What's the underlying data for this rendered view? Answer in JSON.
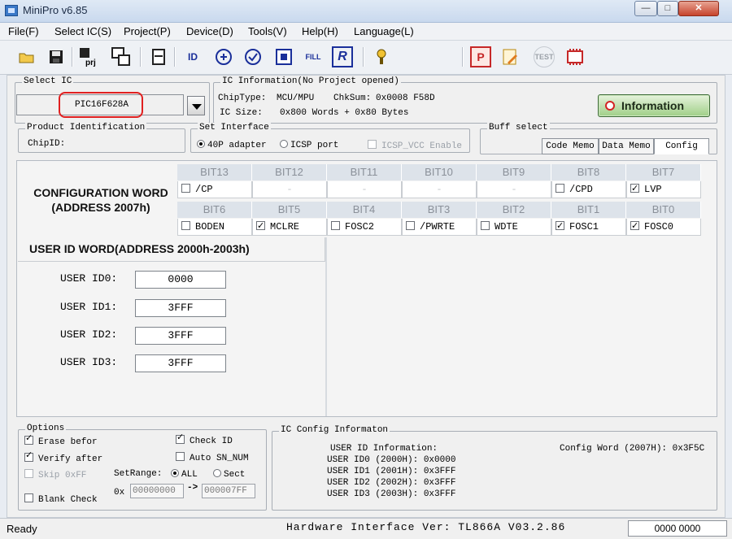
{
  "window": {
    "title": "MiniPro v6.85"
  },
  "menu": [
    "File(F)",
    "Select IC(S)",
    "Project(P)",
    "Device(D)",
    "Tools(V)",
    "Help(H)",
    "Language(L)"
  ],
  "toolbar": {
    "icons": [
      "open-icon",
      "save-icon",
      "save-project-icon",
      "load-project-icon",
      "buffer-icon",
      "read-icon",
      "write-icon",
      "verify-icon",
      "blank-check-icon",
      "fill-icon",
      "read-id-icon",
      "help-icon",
      "program-icon",
      "edit-icon",
      "test-icon",
      "chip-icon"
    ],
    "labels": {
      "read": "ID",
      "fill": "FILL",
      "read_id": "R",
      "program": "P",
      "test": "TEST"
    }
  },
  "select_ic": {
    "legend": "Select IC",
    "value": "PIC16F628A"
  },
  "ic_info": {
    "legend": "IC Information(No Project opened)",
    "chip_type_label": "ChipType:",
    "chip_type": "MCU/MPU",
    "chksum_label": "ChkSum:",
    "chksum": "0x0008 F58D",
    "ic_size_label": "IC Size:",
    "ic_size": "0x800 Words + 0x80 Bytes"
  },
  "info_button": "Information",
  "product_id": {
    "legend": "Product Identification",
    "chip_id_label": "ChipID:"
  },
  "interface": {
    "legend": "Set Interface",
    "adapter": "40P adapter",
    "icsp": "ICSP port",
    "icsp_vcc": "ICSP_VCC Enable"
  },
  "buff": {
    "legend": "Buff select",
    "tabs": [
      "Code Memo",
      "Data Memo",
      "Config"
    ]
  },
  "config": {
    "title_line1": "CONFIGURATION WORD",
    "title_line2": "(ADDRESS 2007h)",
    "row1_heads": [
      "BIT13",
      "BIT12",
      "BIT11",
      "BIT10",
      "BIT9",
      "BIT8",
      "BIT7"
    ],
    "row1_cells": [
      {
        "label": "/CP",
        "checked": false
      },
      {
        "label": "-",
        "dash": true
      },
      {
        "label": "-",
        "dash": true
      },
      {
        "label": "-",
        "dash": true
      },
      {
        "label": "-",
        "dash": true
      },
      {
        "label": "/CPD",
        "checked": false
      },
      {
        "label": "LVP",
        "checked": true
      }
    ],
    "row2_heads": [
      "BIT6",
      "BIT5",
      "BIT4",
      "BIT3",
      "BIT2",
      "BIT1",
      "BIT0"
    ],
    "row2_cells": [
      {
        "label": "BODEN",
        "checked": false
      },
      {
        "label": "MCLRE",
        "checked": true
      },
      {
        "label": "FOSC2",
        "checked": false
      },
      {
        "label": "/PWRTE",
        "checked": false
      },
      {
        "label": "WDTE",
        "checked": false
      },
      {
        "label": "FOSC1",
        "checked": true
      },
      {
        "label": "FOSC0",
        "checked": true
      }
    ]
  },
  "user_id": {
    "title": "USER ID WORD(ADDRESS 2000h-2003h)",
    "rows": [
      {
        "label": "USER ID0:",
        "value": "0000"
      },
      {
        "label": "USER ID1:",
        "value": "3FFF"
      },
      {
        "label": "USER ID2:",
        "value": "3FFF"
      },
      {
        "label": "USER ID3:",
        "value": "3FFF"
      }
    ]
  },
  "options": {
    "legend": "Options",
    "erase": {
      "label": "Erase befor",
      "checked": true
    },
    "verify": {
      "label": "Verify after",
      "checked": true
    },
    "skip": {
      "label": "Skip 0xFF",
      "checked": false
    },
    "blank": {
      "label": "Blank Check",
      "checked": false
    },
    "check_id": {
      "label": "Check ID",
      "checked": true
    },
    "auto_sn": {
      "label": "Auto SN_NUM",
      "checked": false
    },
    "set_range_label": "SetRange:",
    "range_all": "ALL",
    "range_sect": "Sect",
    "range_prefix": "0x",
    "range_from": "00000000",
    "range_arrow": "->",
    "range_to": "000007FF"
  },
  "ic_config_info": {
    "legend": "IC Config Informaton",
    "user_id_header": "USER ID Information:",
    "lines": [
      "USER ID0 (2000H): 0x0000",
      "USER ID1 (2001H): 0x3FFF",
      "USER ID2 (2002H): 0x3FFF",
      "USER ID3 (2003H): 0x3FFF"
    ],
    "config_word": "Config Word (2007H): 0x3F5C"
  },
  "status": {
    "ready": "Ready",
    "hardware": "Hardware Interface Ver: TL866A V03.2.86",
    "counter": "0000 0000"
  },
  "colors": {
    "accent_red": "#e02020",
    "info_green": "#9fcf87",
    "header_gray": "#dde3ea"
  }
}
